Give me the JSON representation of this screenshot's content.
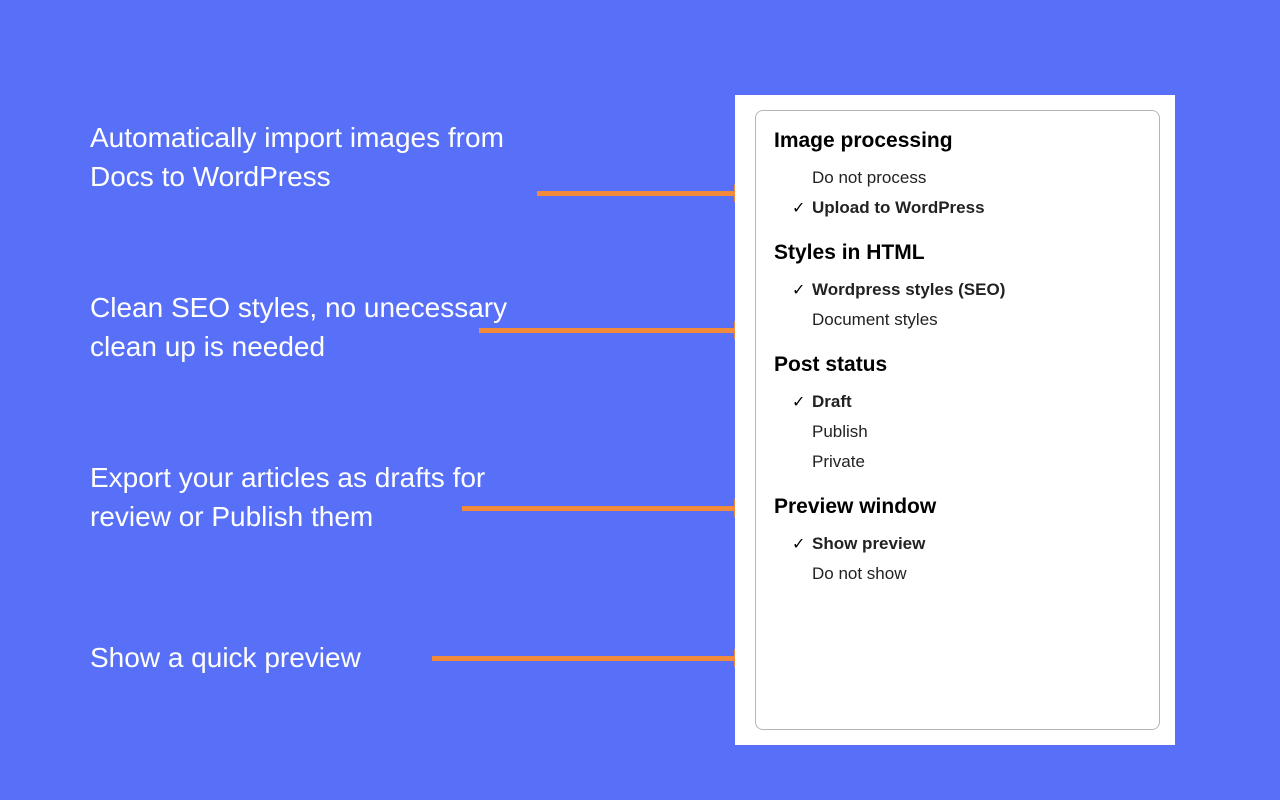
{
  "descriptions": {
    "d1": "Automatically import images from Docs to WordPress",
    "d2": "Clean SEO styles, no unecessary clean up is needed",
    "d3": "Export your articles as drafts for review or Publish them",
    "d4": "Show a quick preview"
  },
  "panel": {
    "image_processing": {
      "title": "Image processing",
      "opt1": "Do not process",
      "opt2": "Upload to WordPress"
    },
    "styles_html": {
      "title": "Styles in HTML",
      "opt1": "Wordpress styles (SEO)",
      "opt2": "Document styles"
    },
    "post_status": {
      "title": "Post status",
      "opt1": "Draft",
      "opt2": "Publish",
      "opt3": "Private"
    },
    "preview_window": {
      "title": "Preview window",
      "opt1": "Show preview",
      "opt2": "Do not show"
    }
  },
  "checkmark": "✓"
}
